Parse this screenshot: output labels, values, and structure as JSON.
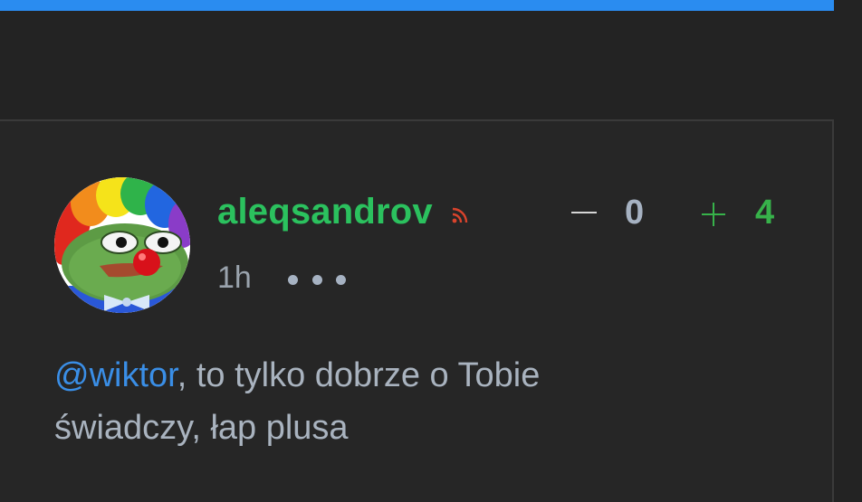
{
  "comment": {
    "author": "aleqsandrov",
    "time": "1h",
    "votes": {
      "down": "0",
      "up": "4"
    },
    "body": {
      "mention": "@wiktor",
      "text_line1": ", to tylko dobrze o Tobie",
      "text_line2": "świadczy, łap plusa"
    },
    "avatar": "clown-pepe-avatar"
  },
  "colors": {
    "accent_bar": "#2a8cf0",
    "username": "#2bc15e",
    "mention": "#3a8ee6",
    "vote_up": "#37b24a",
    "text": "#a9b3bf",
    "background": "#232323",
    "rss": "#d9432c"
  },
  "icons": {
    "feed": "rss-icon",
    "minus": "minus-icon",
    "plus": "plus-icon",
    "menu": "more-dots-icon"
  }
}
